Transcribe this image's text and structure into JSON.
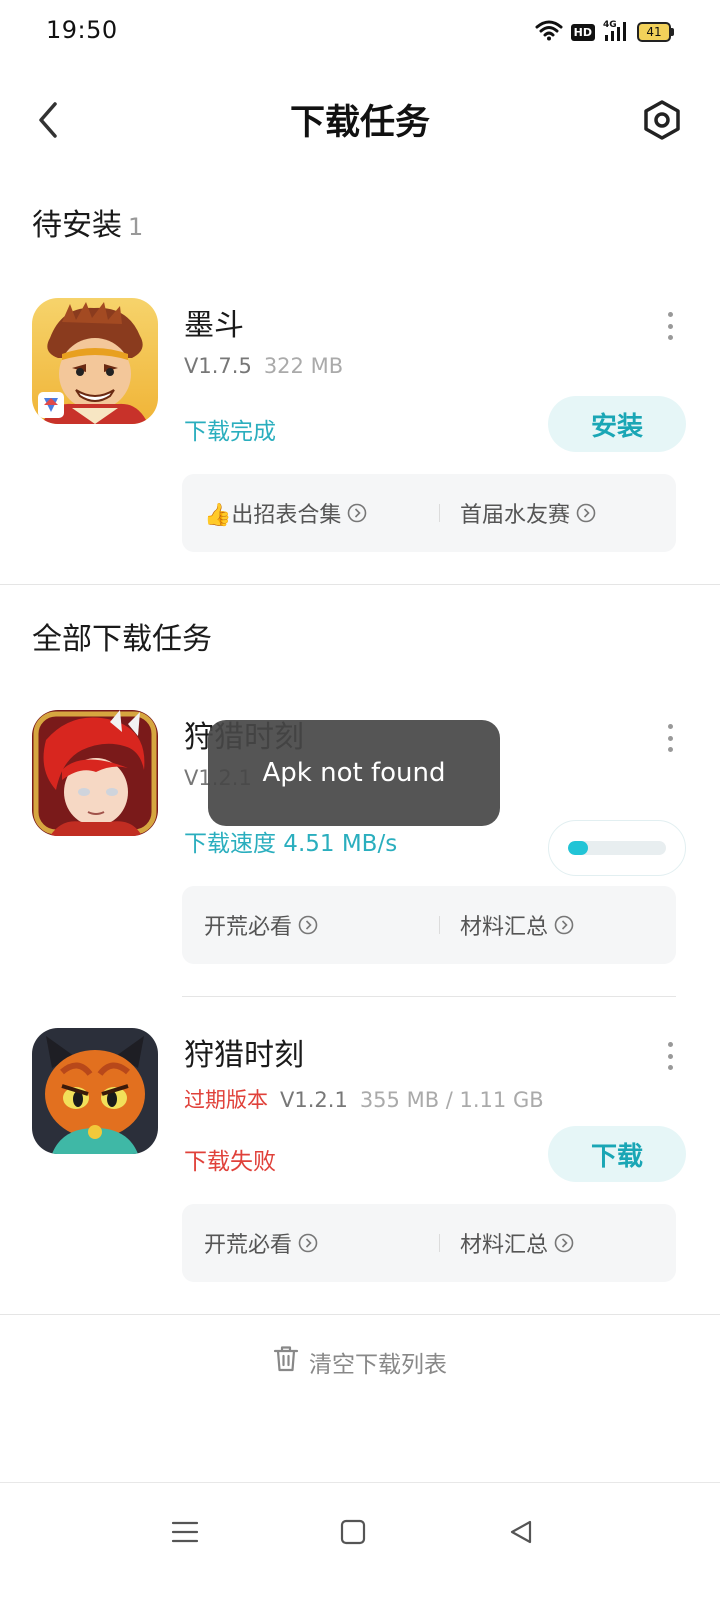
{
  "status_bar": {
    "time": "19:50",
    "hd": "HD",
    "network": "4G",
    "battery": "41",
    "icons": [
      "wifi-icon",
      "hd-icon",
      "signal-4g-icon",
      "battery-icon"
    ]
  },
  "header": {
    "title": "下载任务",
    "back_icon": "chevron-left-icon",
    "settings_icon": "hexagon-settings-icon"
  },
  "pending_section": {
    "title": "待安装",
    "count": "1",
    "app": {
      "name": "墨斗",
      "version": "V1.7.5",
      "size": "322 MB",
      "status": "下载完成",
      "action": "安装",
      "links": [
        "👍出招表合集",
        "首届水友赛"
      ]
    }
  },
  "all_section": {
    "title": "全部下载任务",
    "apps": [
      {
        "name": "狩猎时刻",
        "version": "V1.2.1",
        "size": "",
        "status": "下载速度 4.51 MB/s",
        "progress": 0.08,
        "links": [
          "开荒必看",
          "材料汇总"
        ]
      },
      {
        "name": "狩猎时刻",
        "expired_label": "过期版本",
        "version": "V1.2.1",
        "size": "355 MB / 1.11 GB",
        "status": "下载失败",
        "action": "下载",
        "links": [
          "开荒必看",
          "材料汇总"
        ]
      }
    ]
  },
  "footer": {
    "clear_label": "清空下载列表"
  },
  "toast": {
    "message": "Apk not found"
  },
  "colors": {
    "accent": "#1aa6b5",
    "error": "#e0413a",
    "progress": "#22c4d6"
  }
}
